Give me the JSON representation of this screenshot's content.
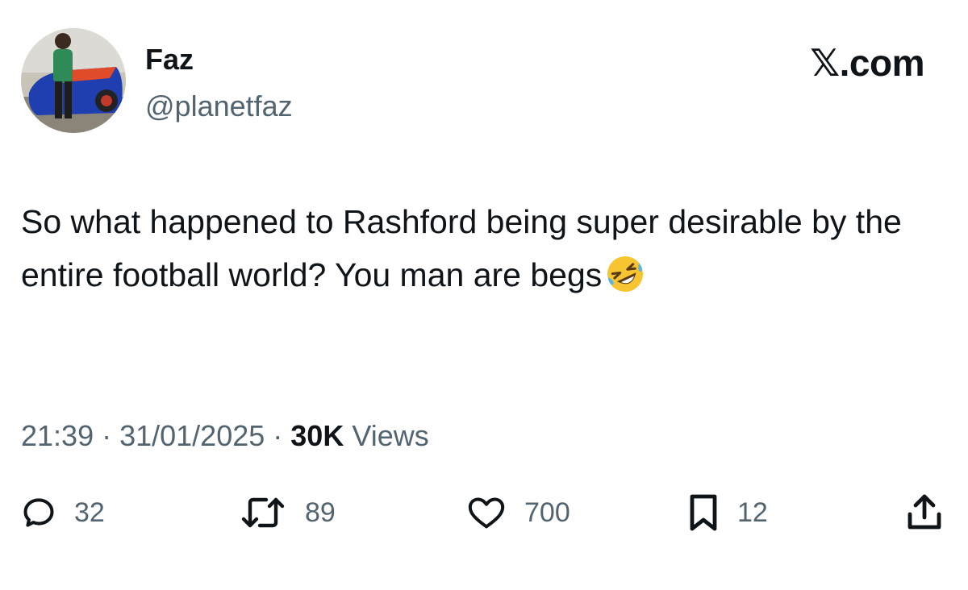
{
  "author": {
    "name": "Faz",
    "handle": "@planetfaz",
    "avatar_icon": "profile-photo-icon"
  },
  "brand": {
    "x": "𝕏",
    "domain": ".com"
  },
  "tweet": {
    "text": "So what happened to Rashford being super desirable by the entire football world? You man are begs",
    "emoji": "rolling-on-floor-laughing-emoji"
  },
  "meta": {
    "time": "21:39",
    "sep1": " · ",
    "date": "31/01/2025",
    "sep2": " · ",
    "views_count": "30K",
    "views_label": " Views"
  },
  "actions": {
    "replies": "32",
    "reposts": "89",
    "likes": "700",
    "bookmarks": "12"
  },
  "colors": {
    "text": "#0f1419",
    "secondary": "#536471",
    "background": "#ffffff"
  }
}
